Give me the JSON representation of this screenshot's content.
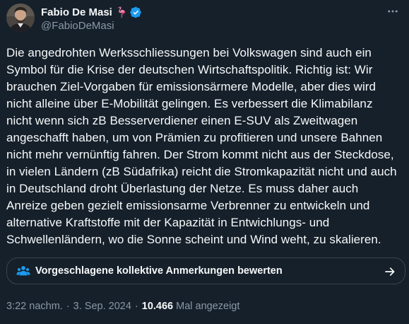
{
  "author": {
    "display_name": "Fabio De Masi",
    "handle": "@FabioDeMasi"
  },
  "tweet": {
    "text": "Die angedrohten Werksschliessungen bei Volkswagen sind auch ein\nSymbol für die Krise der deutschen Wirtschaftspolitik. Richtig ist: Wir\nbrauchen Ziel-Vorgaben für emissionsärmere Modelle, aber dies wird\nnicht alleine über E-Mobilität gelingen. Es verbessert die Klimabilanz\nnicht wenn sich zB Besserverdiener einen E-SUV als Zweitwagen\nangeschafft haben, um von Prämien zu profitieren und unsere Bahnen\nnicht mehr vernünftig fahren. Der Strom kommt nicht aus der Steckdose,\nin vielen Ländern (zB Südafrika) reicht die Stromkapazität nicht und auch\nin Deutschland droht Überlastung der Netze. Es muss daher auch\nAnreize geben gezielt emissionsarme Verbrenner zu entwickeln und\nalternative Kraftstoffe mit der Kapazität in Entwichlungs- und\nSchwellenländern, wo die Sonne scheint und Wind weht, zu skalieren."
  },
  "community_notes": {
    "label": "Vorgeschlagene kollektive Anmerkungen bewerten"
  },
  "meta": {
    "time": "3:22 nachm.",
    "separator": "·",
    "date": "3. Sep. 2024",
    "views_count": "10.466",
    "views_label": "Mal angezeigt"
  },
  "icons": {
    "more": "more-horizontal-icon",
    "verified": "verified-badge-icon",
    "emoji": "flamingo-emoji",
    "notes": "people-icon",
    "arrow": "arrow-right-icon"
  },
  "colors": {
    "background": "#15202b",
    "text": "#f7f9f9",
    "secondary": "#8b98a5",
    "verified": "#1d9bf0",
    "notes_icon": "#1d9bf0",
    "border": "#38444d"
  }
}
